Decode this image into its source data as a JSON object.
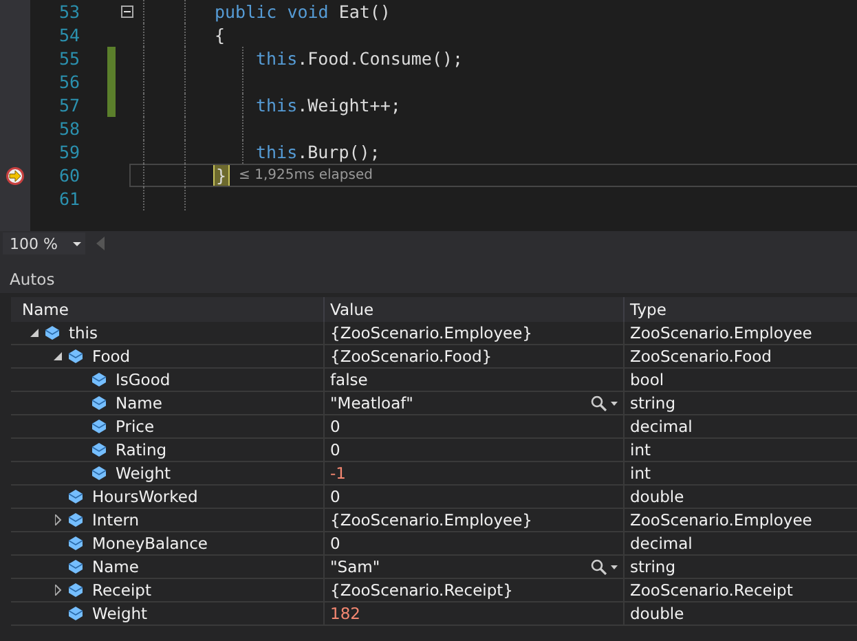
{
  "editor": {
    "lines": [
      {
        "number": "53",
        "changed": false,
        "current": false,
        "collapse": true,
        "segments": [
          {
            "text": "public",
            "kind": "keyword"
          },
          {
            "text": "void",
            "kind": "keyword"
          },
          {
            "text": "Eat()",
            "kind": "plain"
          }
        ]
      },
      {
        "number": "54",
        "changed": false,
        "current": false,
        "collapse": false,
        "segments": [
          {
            "text": "{",
            "kind": "plain"
          }
        ],
        "children": [
          {
            "number": "55",
            "changed": true,
            "current": false,
            "collapse": false,
            "segments": [
              {
                "text": "this",
                "kind": "keyword"
              },
              {
                "text": ".Food.Consume();",
                "kind": "plain"
              }
            ]
          },
          {
            "number": "56",
            "changed": true,
            "current": false,
            "collapse": false
          },
          {
            "number": "57",
            "changed": true,
            "current": false,
            "collapse": false,
            "segments": [
              {
                "text": "this",
                "kind": "keyword"
              },
              {
                "text": ".Weight++;",
                "kind": "plain"
              }
            ]
          },
          {
            "number": "58",
            "changed": false,
            "current": false,
            "collapse": false
          },
          {
            "number": "59",
            "changed": false,
            "current": false,
            "collapse": false,
            "segments": [
              {
                "text": "this",
                "kind": "keyword"
              },
              {
                "text": ".Burp();",
                "kind": "plain"
              }
            ]
          }
        ]
      },
      {
        "number": "60",
        "changed": false,
        "current": true,
        "collapse": false,
        "segments": [
          {
            "text": "}",
            "kind": "brace"
          }
        ],
        "perf_tip": "≤ 1,925ms elapsed"
      },
      {
        "number": "61",
        "changed": false,
        "current": false,
        "collapse": false
      }
    ]
  },
  "zoom": {
    "value": "100 %"
  },
  "autos": {
    "title": "Autos",
    "columns": [
      "Name",
      "Value",
      "Type"
    ],
    "rows": [
      {
        "name": "this",
        "value": "{ZooScenario.Employee}",
        "type": "ZooScenario.Employee",
        "expanded": true,
        "changed": false,
        "visualizer": false,
        "children": [
          {
            "name": "Food",
            "value": "{ZooScenario.Food}",
            "type": "ZooScenario.Food",
            "expanded": true,
            "changed": false,
            "visualizer": false,
            "children": [
              {
                "name": "IsGood",
                "value": "false",
                "type": "bool",
                "changed": false,
                "visualizer": false
              },
              {
                "name": "Name",
                "value": "\"Meatloaf\"",
                "type": "string",
                "changed": false,
                "visualizer": true
              },
              {
                "name": "Price",
                "value": "0",
                "type": "decimal",
                "changed": false,
                "visualizer": false
              },
              {
                "name": "Rating",
                "value": "0",
                "type": "int",
                "changed": false,
                "visualizer": false
              },
              {
                "name": "Weight",
                "value": "-1",
                "type": "int",
                "changed": true,
                "visualizer": false
              }
            ]
          },
          {
            "name": "HoursWorked",
            "value": "0",
            "type": "double",
            "changed": false,
            "visualizer": false
          },
          {
            "name": "Intern",
            "value": "{ZooScenario.Employee}",
            "type": "ZooScenario.Employee",
            "expanded": false,
            "changed": false,
            "visualizer": false
          },
          {
            "name": "MoneyBalance",
            "value": "0",
            "type": "decimal",
            "changed": false,
            "visualizer": false
          },
          {
            "name": "Name",
            "value": "\"Sam\"",
            "type": "string",
            "changed": false,
            "visualizer": true
          },
          {
            "name": "Receipt",
            "value": "{ZooScenario.Receipt}",
            "type": "ZooScenario.Receipt",
            "expanded": false,
            "changed": false,
            "visualizer": false
          },
          {
            "name": "Weight",
            "value": "182",
            "type": "double",
            "changed": true,
            "visualizer": false
          }
        ]
      }
    ]
  }
}
